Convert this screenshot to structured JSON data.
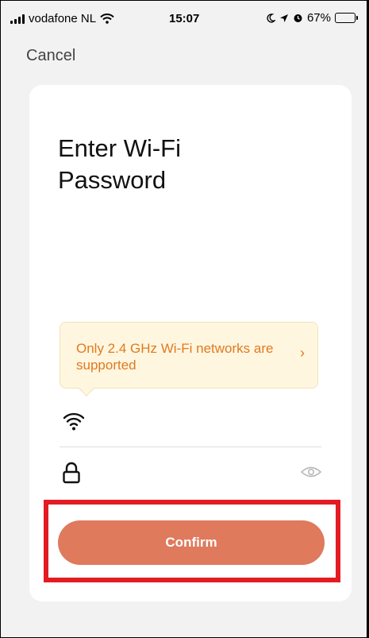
{
  "status_bar": {
    "carrier": "vodafone NL",
    "time": "15:07",
    "battery_percent": "67%",
    "battery_level": 0.67
  },
  "header": {
    "cancel_label": "Cancel"
  },
  "main": {
    "title": "Enter Wi-Fi Password",
    "notice": {
      "text": "Only 2.4 GHz Wi-Fi networks are supported",
      "chevron": "›"
    },
    "wifi_field": {
      "value": "",
      "icon": "wifi-icon"
    },
    "password_field": {
      "value": "",
      "icon": "lock-icon",
      "toggle_icon": "eye-icon"
    },
    "confirm_label": "Confirm"
  },
  "colors": {
    "accent": "#df7a5d",
    "notice_bg": "#fff6e0",
    "notice_text": "#e07a1f",
    "highlight": "#e31b23"
  }
}
